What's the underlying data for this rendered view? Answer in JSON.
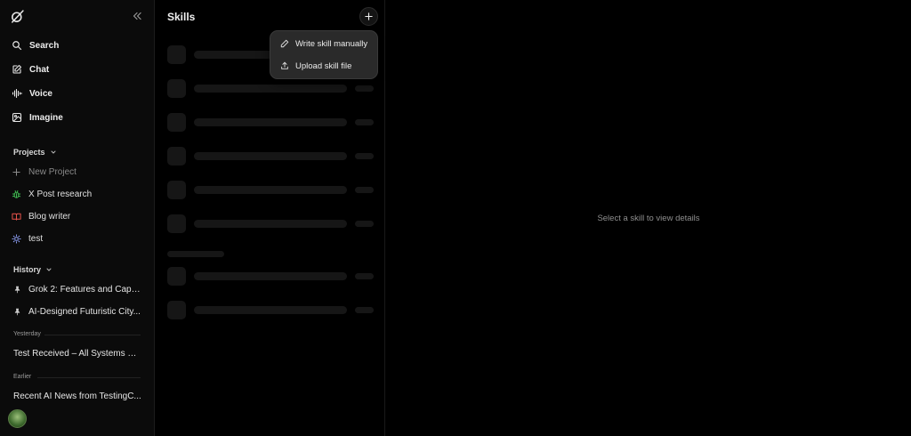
{
  "sidebar": {
    "nav": [
      {
        "label": "Search",
        "icon": "search-icon"
      },
      {
        "label": "Chat",
        "icon": "edit-icon"
      },
      {
        "label": "Voice",
        "icon": "waveform-icon"
      },
      {
        "label": "Imagine",
        "icon": "image-icon"
      }
    ],
    "projects_heading": "Projects",
    "projects": [
      {
        "label": "New Project",
        "icon": "plus-icon"
      },
      {
        "label": "X Post research",
        "icon": "bug-icon",
        "color": "#3fb950"
      },
      {
        "label": "Blog writer",
        "icon": "book-icon",
        "color": "#e5534b"
      },
      {
        "label": "test",
        "icon": "sun-icon",
        "color": "#8b9cf0"
      }
    ],
    "history_heading": "History",
    "pinned": [
      {
        "label": "Grok 2: Features and Capa..."
      },
      {
        "label": "AI-Designed Futuristic City..."
      }
    ],
    "groups": [
      {
        "label": "Yesterday",
        "items": [
          "Test Received – All Systems No..."
        ]
      },
      {
        "label": "Earlier",
        "items": [
          "Recent AI News from TestingC..."
        ]
      }
    ]
  },
  "skills": {
    "title": "Skills"
  },
  "menu": {
    "items": [
      {
        "label": "Write skill manually",
        "icon": "pencil-icon"
      },
      {
        "label": "Upload skill file",
        "icon": "upload-icon"
      }
    ]
  },
  "detail": {
    "empty_text": "Select a skill to view details"
  }
}
